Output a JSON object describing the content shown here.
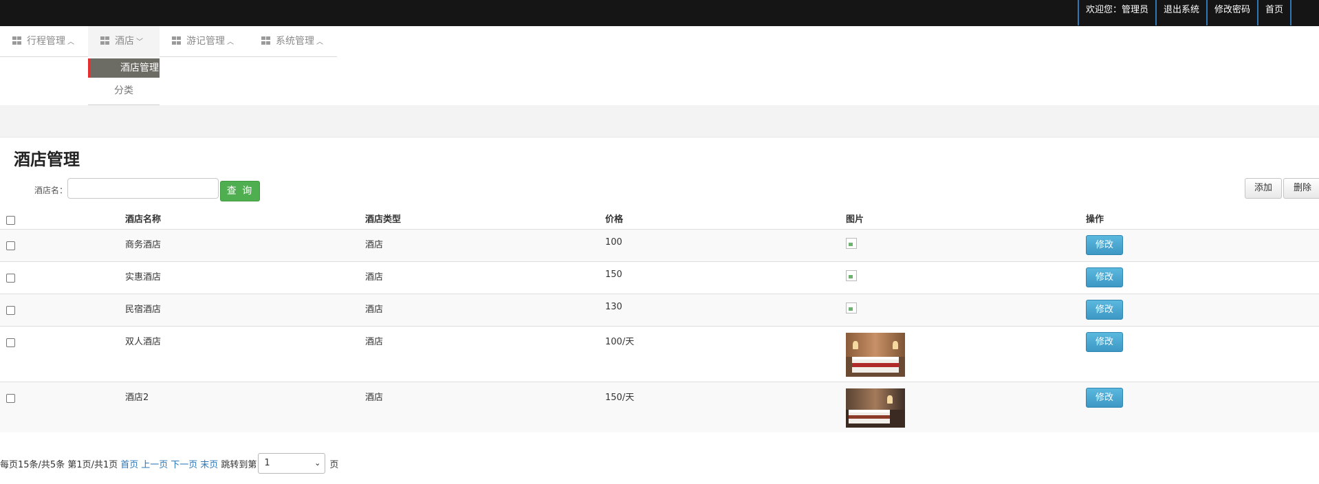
{
  "topbar": {
    "welcome": "欢迎您：管理员",
    "logout": "退出系统",
    "change_password": "修改密码",
    "home": "首页"
  },
  "nav": {
    "items": [
      {
        "label": "行程管理",
        "chevron": "^"
      },
      {
        "label": "酒店",
        "chevron": "v"
      },
      {
        "label": "游记管理",
        "chevron": "^"
      },
      {
        "label": "系统管理",
        "chevron": "^"
      }
    ],
    "dropdown": [
      "酒店管理",
      "分类"
    ]
  },
  "page": {
    "title": "酒店管理",
    "search_label": "酒店名：",
    "search_value": "",
    "query_button": "查 询",
    "add_button": "添加",
    "delete_button": "删除"
  },
  "table": {
    "headers": [
      "酒店名称",
      "酒店类型",
      "价格",
      "图片",
      "操作"
    ],
    "rows": [
      {
        "name": "商务酒店",
        "type": "酒店",
        "price": "100",
        "image": "broken",
        "action": "修改"
      },
      {
        "name": "实惠酒店",
        "type": "酒店",
        "price": "150",
        "image": "broken",
        "action": "修改"
      },
      {
        "name": "民宿酒店",
        "type": "酒店",
        "price": "130",
        "image": "broken",
        "action": "修改"
      },
      {
        "name": "双人酒店",
        "type": "酒店",
        "price": "100/天",
        "image": "hotel-room-photo",
        "action": "修改"
      },
      {
        "name": "酒店2",
        "type": "酒店",
        "price": "150/天",
        "image": "hotel-room-photo",
        "action": "修改"
      }
    ]
  },
  "pager": {
    "summary": "每页15条/共5条 第1页/共1页",
    "first": "首页",
    "prev": "上一页",
    "next": "下一页",
    "last": "末页",
    "jump_label": "跳转到第",
    "page_value": "1",
    "page_suffix": "页"
  }
}
